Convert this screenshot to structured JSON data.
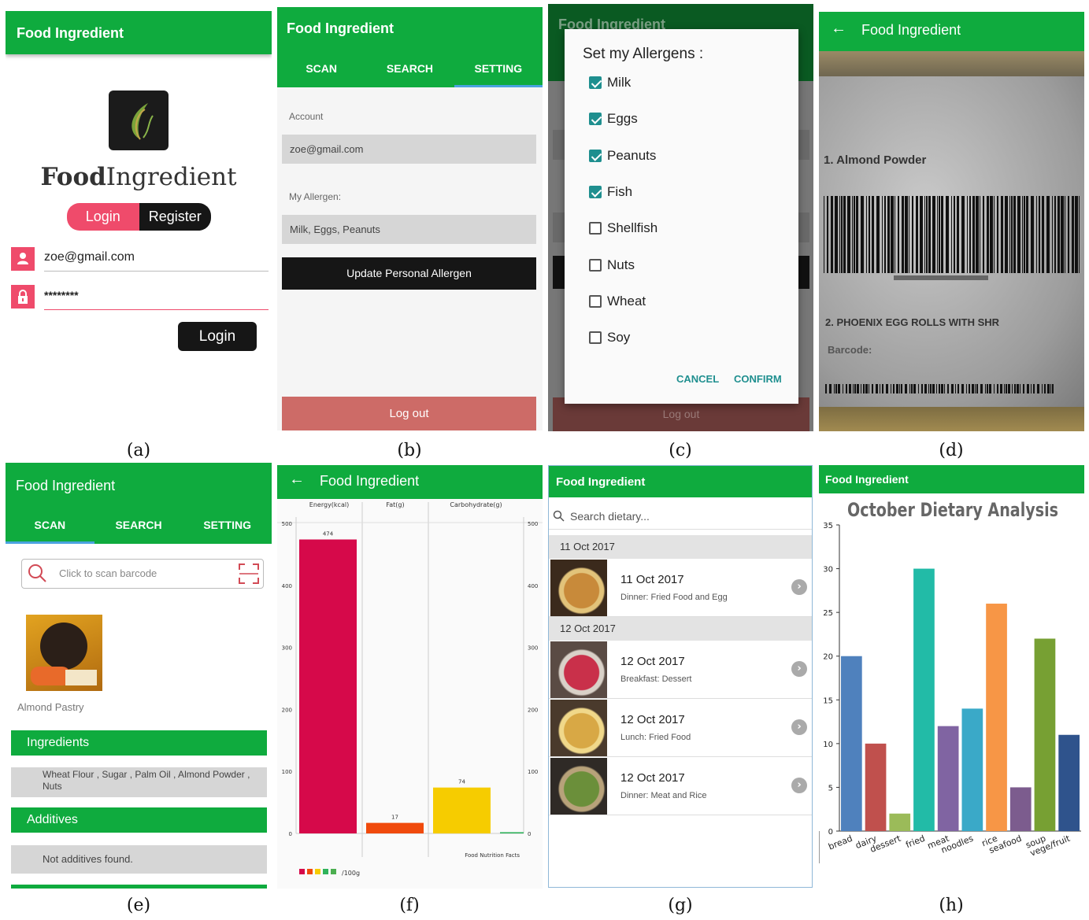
{
  "captions": [
    "(a)",
    "(b)",
    "(c)",
    "(d)",
    "(e)",
    "(f)",
    "(g)",
    "(h)"
  ],
  "app_title": "Food Ingredient",
  "colors": {
    "primary": "#0fab3e",
    "accent_pink": "#ef4b6b",
    "dark": "#161616",
    "logout": "#cd6b67",
    "teal": "#1f8f8f"
  },
  "a": {
    "logo_bold": "Food",
    "logo_regular": "Ingredient",
    "seg_login": "Login",
    "seg_register": "Register",
    "email": "zoe@gmail.com",
    "password": "********",
    "login_button": "Login",
    "icons": [
      "person-icon",
      "lock-icon"
    ]
  },
  "b": {
    "tabs": [
      "SCAN",
      "SEARCH",
      "SETTING"
    ],
    "account_label": "Account",
    "account_value": "zoe@gmail.com",
    "allergen_label": "My Allergen:",
    "allergen_value": "Milk, Eggs, Peanuts",
    "update_button": "Update Personal Allergen",
    "logout_button": "Log out"
  },
  "c": {
    "dialog_title": "Set my Allergens :",
    "items": [
      {
        "label": "Milk",
        "checked": true
      },
      {
        "label": "Eggs",
        "checked": true
      },
      {
        "label": "Peanuts",
        "checked": true
      },
      {
        "label": "Fish",
        "checked": true
      },
      {
        "label": "Shellfish",
        "checked": false
      },
      {
        "label": "Nuts",
        "checked": false
      },
      {
        "label": "Wheat",
        "checked": false
      },
      {
        "label": "Soy",
        "checked": false
      }
    ],
    "cancel": "CANCEL",
    "confirm": "CONFIRM",
    "bg_logout": "Log out"
  },
  "d": {
    "line1": "1. Almond Powder",
    "line2": "2. PHOENIX EGG ROLLS WITH SHR",
    "line3": "Barcode:"
  },
  "e": {
    "tabs": [
      "SCAN",
      "SEARCH",
      "SETTING"
    ],
    "search_placeholder": "Click to scan barcode",
    "product_name": "Almond Pastry",
    "ingredients_header": "Ingredients",
    "ingredients_text": "Wheat Flour , Sugar , Palm Oil , Almond Powder , Nuts",
    "additives_header": "Additives",
    "additives_text": "Not additives found."
  },
  "f": {
    "legend_text": "/100g",
    "footer_text": "Food Nutrition Facts"
  },
  "g": {
    "search_placeholder": "Search dietary...",
    "groups": [
      {
        "date": "11 Oct 2017",
        "entries": [
          {
            "title": "11 Oct 2017",
            "subtitle": "Dinner: Fried Food and Egg"
          }
        ]
      },
      {
        "date": "12 Oct 2017",
        "entries": [
          {
            "title": "12 Oct 2017",
            "subtitle": "Breakfast: Dessert"
          },
          {
            "title": "12 Oct 2017",
            "subtitle": "Lunch: Fried Food"
          },
          {
            "title": "12 Oct 2017",
            "subtitle": "Dinner: Meat and Rice"
          }
        ]
      }
    ]
  },
  "chart_data": [
    {
      "type": "bar",
      "categories": [
        "Energy(kcal)",
        "Fat(g)",
        "Carbohydrate(g)"
      ],
      "values": [
        474,
        17,
        74,
        2
      ],
      "bar_labels": [
        "474",
        "17",
        "74",
        ""
      ],
      "bar_colors": [
        "#d6094a",
        "#f04a0c",
        "#f6cc00",
        "#2fb35b"
      ],
      "ylim": [
        0,
        500
      ],
      "yticks": [
        0,
        100,
        200,
        300,
        400,
        500
      ],
      "legend_colors": [
        "#d6094a",
        "#f04a0c",
        "#f6cc00",
        "#2fb35b",
        "#4caf50"
      ]
    },
    {
      "type": "bar",
      "title": "October Dietary Analysis",
      "categories": [
        "bread",
        "dairy",
        "dessert",
        "fried",
        "meat",
        "noodles",
        "rice",
        "seafood",
        "soup",
        "vege/fruit"
      ],
      "values": [
        20,
        10,
        2,
        30,
        12,
        14,
        26,
        5,
        22,
        11
      ],
      "colors": [
        "#4f81bd",
        "#c0504d",
        "#9bbb59",
        "#22bba7",
        "#8064a2",
        "#3aa9c8",
        "#f79646",
        "#7c5c8e",
        "#77a033",
        "#2f538c"
      ],
      "ylim": [
        0,
        35
      ],
      "yticks": [
        0,
        5,
        10,
        15,
        20,
        25,
        30,
        35
      ]
    }
  ]
}
